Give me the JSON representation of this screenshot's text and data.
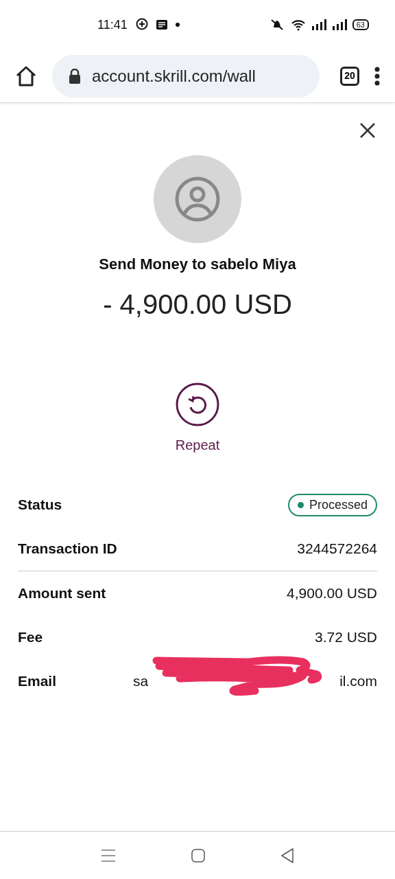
{
  "status_bar": {
    "time": "11:41",
    "battery": "63"
  },
  "browser": {
    "url": "account.skrill.com/wall",
    "tab_count": "20"
  },
  "transaction": {
    "title": "Send Money to sabelo Miya",
    "amount": "- 4,900.00 USD",
    "action": "Repeat"
  },
  "details": [
    {
      "kind": "status",
      "label": "Status",
      "value": "Processed",
      "color": "#1f8a6e"
    },
    {
      "kind": "text",
      "label": "Transaction ID",
      "value": "3244572264",
      "divider_after": true
    },
    {
      "kind": "text",
      "label": "Amount sent",
      "value": "4,900.00 USD"
    },
    {
      "kind": "text",
      "label": "Fee",
      "value": "3.72 USD"
    },
    {
      "kind": "redacted",
      "label": "Email",
      "value_start": "sa",
      "value_end": "il.com"
    }
  ]
}
